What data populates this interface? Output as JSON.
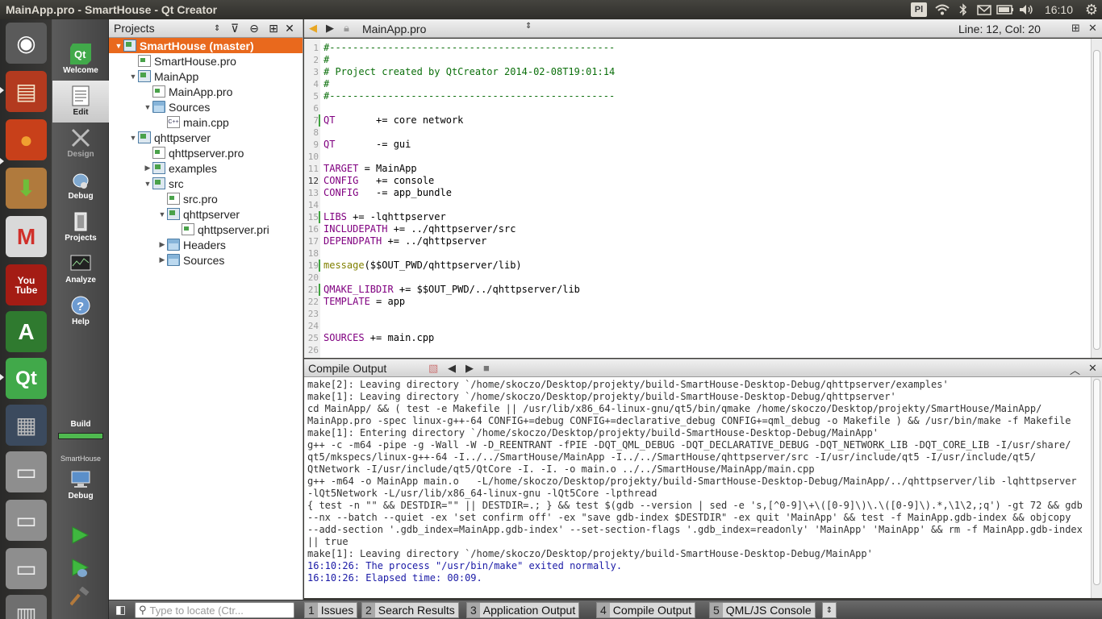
{
  "window": {
    "title": "MainApp.pro - SmartHouse - Qt Creator"
  },
  "tray": {
    "keyboard": "Pl",
    "clock": "16:10"
  },
  "modes": [
    {
      "label": "Welcome",
      "icon": "qt-welcome-icon"
    },
    {
      "label": "Edit",
      "icon": "edit-icon"
    },
    {
      "label": "Design",
      "icon": "design-icon"
    },
    {
      "label": "Debug",
      "icon": "debug-icon"
    },
    {
      "label": "Projects",
      "icon": "projects-icon"
    },
    {
      "label": "Analyze",
      "icon": "analyze-icon"
    },
    {
      "label": "Help",
      "icon": "help-icon"
    }
  ],
  "build": {
    "label": "Build",
    "progress": 1.0,
    "target_project": "SmartHouse",
    "target_label": "Debug"
  },
  "projects_panel": {
    "title": "Projects",
    "tree": [
      {
        "label": "SmartHouse (master)",
        "icon": "proj",
        "depth": 0,
        "arrow": "down",
        "selected": true
      },
      {
        "label": "SmartHouse.pro",
        "icon": "pro",
        "depth": 1,
        "arrow": ""
      },
      {
        "label": "MainApp",
        "icon": "proj",
        "depth": 1,
        "arrow": "down"
      },
      {
        "label": "MainApp.pro",
        "icon": "pro",
        "depth": 2,
        "arrow": ""
      },
      {
        "label": "Sources",
        "icon": "folder",
        "depth": 2,
        "arrow": "down"
      },
      {
        "label": "main.cpp",
        "icon": "cpp",
        "depth": 3,
        "arrow": ""
      },
      {
        "label": "qhttpserver",
        "icon": "proj",
        "depth": 1,
        "arrow": "down"
      },
      {
        "label": "qhttpserver.pro",
        "icon": "pro",
        "depth": 2,
        "arrow": ""
      },
      {
        "label": "examples",
        "icon": "proj",
        "depth": 2,
        "arrow": "right"
      },
      {
        "label": "src",
        "icon": "proj",
        "depth": 2,
        "arrow": "down"
      },
      {
        "label": "src.pro",
        "icon": "pro",
        "depth": 3,
        "arrow": ""
      },
      {
        "label": "qhttpserver",
        "icon": "proj",
        "depth": 3,
        "arrow": "down"
      },
      {
        "label": "qhttpserver.pri",
        "icon": "pro",
        "depth": 4,
        "arrow": ""
      },
      {
        "label": "Headers",
        "icon": "folder",
        "depth": 3,
        "arrow": "right"
      },
      {
        "label": "Sources",
        "icon": "folder",
        "depth": 3,
        "arrow": "right"
      }
    ]
  },
  "editor": {
    "file": "MainApp.pro",
    "position": "Line: 12, Col: 20",
    "current_line": 12,
    "changed_lines": [
      7,
      15,
      19,
      21
    ],
    "lines": [
      {
        "n": "1",
        "t": "#-------------------------------------------------",
        "c": "cm"
      },
      {
        "n": "2",
        "t": "#",
        "c": "cm"
      },
      {
        "n": "3",
        "t": "# Project created by QtCreator 2014-02-08T19:01:14",
        "c": "cm"
      },
      {
        "n": "4",
        "t": "#",
        "c": "cm"
      },
      {
        "n": "5",
        "t": "#-------------------------------------------------",
        "c": "cm"
      },
      {
        "n": "6",
        "t": "",
        "c": ""
      },
      {
        "n": "7",
        "k": "QT",
        "t": "       += core network",
        "c": "kw"
      },
      {
        "n": "8",
        "t": "",
        "c": ""
      },
      {
        "n": "9",
        "k": "QT",
        "t": "       -= gui",
        "c": "kw"
      },
      {
        "n": "10",
        "t": "",
        "c": ""
      },
      {
        "n": "11",
        "k": "TARGET",
        "t": " = MainApp",
        "c": "kw"
      },
      {
        "n": "12",
        "k": "CONFIG",
        "t": "   += console",
        "c": "kw"
      },
      {
        "n": "13",
        "k": "CONFIG",
        "t": "   -= app_bundle",
        "c": "kw"
      },
      {
        "n": "14",
        "t": "",
        "c": ""
      },
      {
        "n": "15",
        "k": "LIBS",
        "t": " += -lqhttpserver",
        "c": "kw"
      },
      {
        "n": "16",
        "k": "INCLUDEPATH",
        "t": " += ../qhttpserver/src",
        "c": "kw"
      },
      {
        "n": "17",
        "k": "DEPENDPATH",
        "t": " += ../qhttpserver",
        "c": "kw"
      },
      {
        "n": "18",
        "t": "",
        "c": ""
      },
      {
        "n": "19",
        "k": "message",
        "t": "($$OUT_PWD/qhttpserver/lib)",
        "c": "fn"
      },
      {
        "n": "20",
        "t": "",
        "c": ""
      },
      {
        "n": "21",
        "k": "QMAKE_LIBDIR",
        "t": " += $$OUT_PWD/../qhttpserver/lib",
        "c": "kw"
      },
      {
        "n": "22",
        "k": "TEMPLATE",
        "t": " = app",
        "c": "kw"
      },
      {
        "n": "23",
        "t": "",
        "c": ""
      },
      {
        "n": "24",
        "t": "",
        "c": ""
      },
      {
        "n": "25",
        "k": "SOURCES",
        "t": " += main.cpp",
        "c": "kw"
      },
      {
        "n": "26",
        "t": "",
        "c": ""
      }
    ]
  },
  "output": {
    "title": "Compile Output",
    "lines": [
      {
        "t": "make[2]: Leaving directory `/home/skoczo/Desktop/projekty/build-SmartHouse-Desktop-Debug/qhttpserver/examples'",
        "c": ""
      },
      {
        "t": "make[1]: Leaving directory `/home/skoczo/Desktop/projekty/build-SmartHouse-Desktop-Debug/qhttpserver'",
        "c": ""
      },
      {
        "t": "cd MainApp/ && ( test -e Makefile || /usr/lib/x86_64-linux-gnu/qt5/bin/qmake /home/skoczo/Desktop/projekty/SmartHouse/MainApp/",
        "c": ""
      },
      {
        "t": "MainApp.pro -spec linux-g++-64 CONFIG+=debug CONFIG+=declarative_debug CONFIG+=qml_debug -o Makefile ) && /usr/bin/make -f Makefile",
        "c": ""
      },
      {
        "t": "make[1]: Entering directory `/home/skoczo/Desktop/projekty/build-SmartHouse-Desktop-Debug/MainApp'",
        "c": ""
      },
      {
        "t": "g++ -c -m64 -pipe -g -Wall -W -D_REENTRANT -fPIE -DQT_QML_DEBUG -DQT_DECLARATIVE_DEBUG -DQT_NETWORK_LIB -DQT_CORE_LIB -I/usr/share/",
        "c": ""
      },
      {
        "t": "qt5/mkspecs/linux-g++-64 -I../../SmartHouse/MainApp -I../../SmartHouse/qhttpserver/src -I/usr/include/qt5 -I/usr/include/qt5/",
        "c": ""
      },
      {
        "t": "QtNetwork -I/usr/include/qt5/QtCore -I. -I. -o main.o ../../SmartHouse/MainApp/main.cpp",
        "c": ""
      },
      {
        "t": "g++ -m64 -o MainApp main.o   -L/home/skoczo/Desktop/projekty/build-SmartHouse-Desktop-Debug/MainApp/../qhttpserver/lib -lqhttpserver",
        "c": ""
      },
      {
        "t": "-lQt5Network -L/usr/lib/x86_64-linux-gnu -lQt5Core -lpthread",
        "c": ""
      },
      {
        "t": "{ test -n \"\" && DESTDIR=\"\" || DESTDIR=.; } && test $(gdb --version | sed -e 's,[^0-9]\\+\\([0-9]\\)\\.\\([0-9]\\).*,\\1\\2,;q') -gt 72 && gdb",
        "c": ""
      },
      {
        "t": "--nx --batch --quiet -ex 'set confirm off' -ex \"save gdb-index $DESTDIR\" -ex quit 'MainApp' && test -f MainApp.gdb-index && objcopy",
        "c": ""
      },
      {
        "t": "--add-section '.gdb_index=MainApp.gdb-index' --set-section-flags '.gdb_index=readonly' 'MainApp' 'MainApp' && rm -f MainApp.gdb-index",
        "c": ""
      },
      {
        "t": "|| true",
        "c": ""
      },
      {
        "t": "make[1]: Leaving directory `/home/skoczo/Desktop/projekty/build-SmartHouse-Desktop-Debug/MainApp'",
        "c": ""
      },
      {
        "t": "16:10:26: The process \"/usr/bin/make\" exited normally.",
        "c": "blue"
      },
      {
        "t": "16:10:26: Elapsed time: 00:09.",
        "c": "blue"
      }
    ]
  },
  "bottom": {
    "locate_placeholder": "Type to locate (Ctr...",
    "tabs": [
      {
        "num": "1",
        "label": "Issues"
      },
      {
        "num": "2",
        "label": "Search Results"
      },
      {
        "num": "3",
        "label": "Application Output"
      },
      {
        "num": "4",
        "label": "Compile Output"
      },
      {
        "num": "5",
        "label": "QML/JS Console"
      }
    ]
  },
  "launcher": [
    {
      "name": "ubuntu-dash-icon",
      "glyph": "◉",
      "bg": "#5a5a5a",
      "fg": "#fff"
    },
    {
      "name": "files-icon",
      "glyph": "▤",
      "bg": "#b33a1f",
      "fg": "#f3e3c8"
    },
    {
      "name": "firefox-icon",
      "glyph": "●",
      "bg": "#c8401a",
      "fg": "#f0a030"
    },
    {
      "name": "archive-icon",
      "glyph": "⬇",
      "bg": "#b07a3d",
      "fg": "#6fbe3a"
    },
    {
      "name": "gmail-icon",
      "glyph": "M",
      "bg": "#d9d9d9",
      "fg": "#d0302a"
    },
    {
      "name": "youtube-icon",
      "glyph": "You Tube",
      "bg": "#a41c14",
      "fg": "#fff"
    },
    {
      "name": "software-updater-icon",
      "glyph": "A",
      "bg": "#2f7a2f",
      "fg": "#fff"
    },
    {
      "name": "qtcreator-launcher-icon",
      "glyph": "Qt",
      "bg": "#41a94a",
      "fg": "#fff"
    },
    {
      "name": "workspace-switcher-icon",
      "glyph": "▦",
      "bg": "#3b4a5e",
      "fg": "#bbb"
    },
    {
      "name": "drive-icon-1",
      "glyph": "▭",
      "bg": "#8e8e8e",
      "fg": "#eee"
    },
    {
      "name": "drive-icon-2",
      "glyph": "▭",
      "bg": "#8e8e8e",
      "fg": "#eee"
    },
    {
      "name": "drive-icon-3",
      "glyph": "▭",
      "bg": "#8e8e8e",
      "fg": "#eee"
    },
    {
      "name": "trash-icon",
      "glyph": "▥",
      "bg": "#6f6f6f",
      "fg": "#ddd"
    }
  ]
}
